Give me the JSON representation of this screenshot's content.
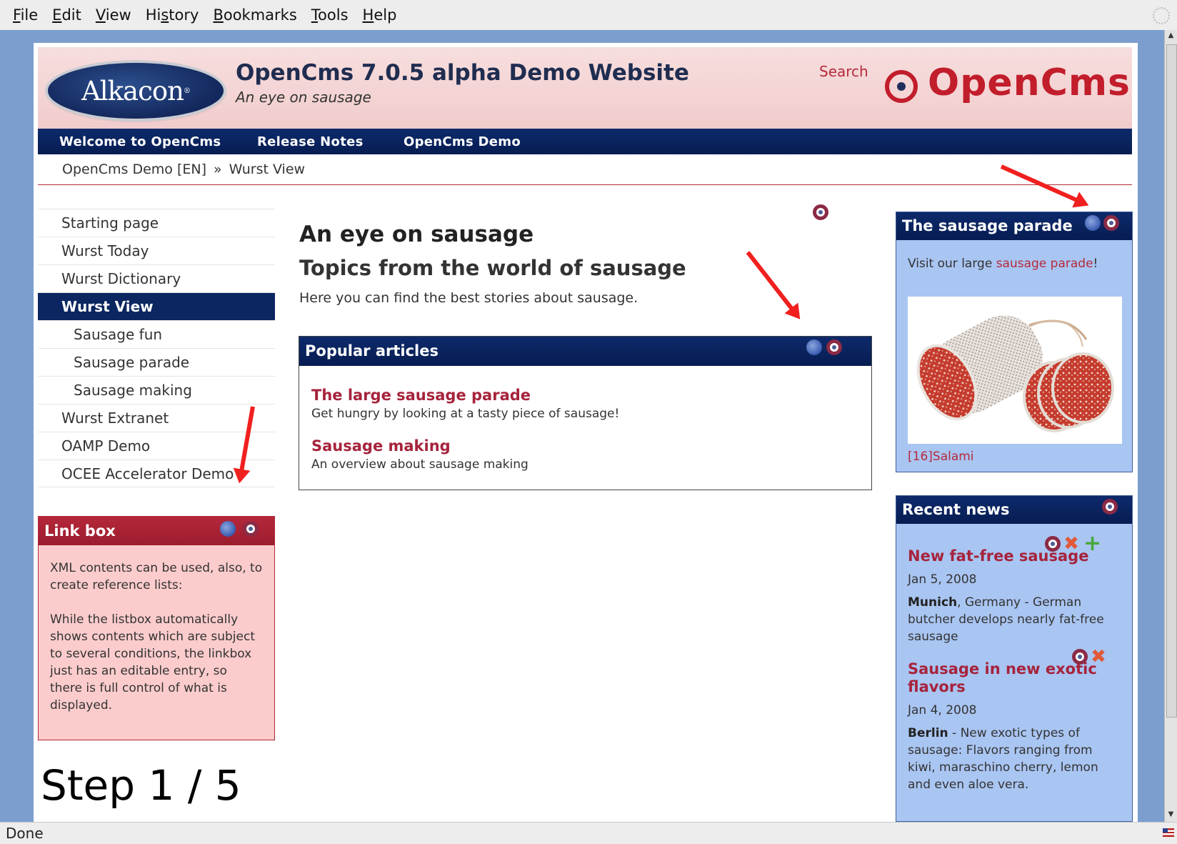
{
  "browser": {
    "menu": [
      "File",
      "Edit",
      "View",
      "History",
      "Bookmarks",
      "Tools",
      "Help"
    ],
    "menu_access_keys": [
      "F",
      "E",
      "V",
      "s",
      "B",
      "T",
      "H"
    ],
    "status": "Done"
  },
  "header": {
    "alkacon_logo": "Alkacon",
    "title": "OpenCms 7.0.5 alpha Demo Website",
    "subtitle": "An eye on sausage",
    "search": "Search",
    "opencms_logo": "OpenCms"
  },
  "nav": [
    "Welcome to OpenCms",
    "Release Notes",
    "OpenCms Demo"
  ],
  "breadcrumb": {
    "items": [
      "OpenCms Demo [EN]",
      "Wurst View"
    ],
    "separator": "»"
  },
  "sidebar": {
    "items": [
      {
        "label": "Starting page",
        "level": 1,
        "active": false
      },
      {
        "label": "Wurst Today",
        "level": 1,
        "active": false
      },
      {
        "label": "Wurst Dictionary",
        "level": 1,
        "active": false
      },
      {
        "label": "Wurst View",
        "level": 1,
        "active": true
      },
      {
        "label": "Sausage fun",
        "level": 2,
        "active": false
      },
      {
        "label": "Sausage parade",
        "level": 2,
        "active": false
      },
      {
        "label": "Sausage making",
        "level": 2,
        "active": false
      },
      {
        "label": "Wurst Extranet",
        "level": 1,
        "active": false
      },
      {
        "label": "OAMP Demo",
        "level": 1,
        "active": false
      },
      {
        "label": "OCEE Accelerator Demo",
        "level": 1,
        "active": false
      }
    ]
  },
  "linkbox": {
    "title": "Link box",
    "para1": "XML contents can be used, also, to create reference lists:",
    "para2": "While the listbox automatically shows contents which are subject to several conditions, the linkbox just has an editable entry, so there is full control of what is displayed."
  },
  "main": {
    "title": "An eye on sausage",
    "subtitle": "Topics from the world of sausage",
    "lead": "Here you can find the best stories about sausage.",
    "popular": {
      "title": "Popular articles",
      "articles": [
        {
          "title": "The large sausage parade",
          "desc": "Get hungry by looking at a tasty piece of sausage!"
        },
        {
          "title": "Sausage making",
          "desc": "An overview about sausage making"
        }
      ]
    }
  },
  "parade": {
    "title": "The sausage parade",
    "text_before": "Visit our large ",
    "link": "sausage parade",
    "text_after": "!",
    "caption": "[16]Salami"
  },
  "news": {
    "title": "Recent news",
    "items": [
      {
        "title": "New fat-free sausage",
        "date": "Jan 5, 2008",
        "place": "Munich",
        "desc": ", Germany - German butcher develops nearly fat-free sausage"
      },
      {
        "title": "Sausage in new exotic flavors",
        "date": "Jan 4, 2008",
        "place": "Berlin",
        "desc": " - New exotic types of sausage: Flavors ranging from kiwi,  maraschino  cherry, lemon and even aloe vera."
      }
    ]
  },
  "overlay": {
    "step": "Step 1 / 5"
  },
  "colors": {
    "nav": "#0b2660",
    "accent": "#b52a3a",
    "box_blue": "#a9c5f2",
    "box_pink": "#fccccc",
    "arrow": "#f0201e"
  }
}
